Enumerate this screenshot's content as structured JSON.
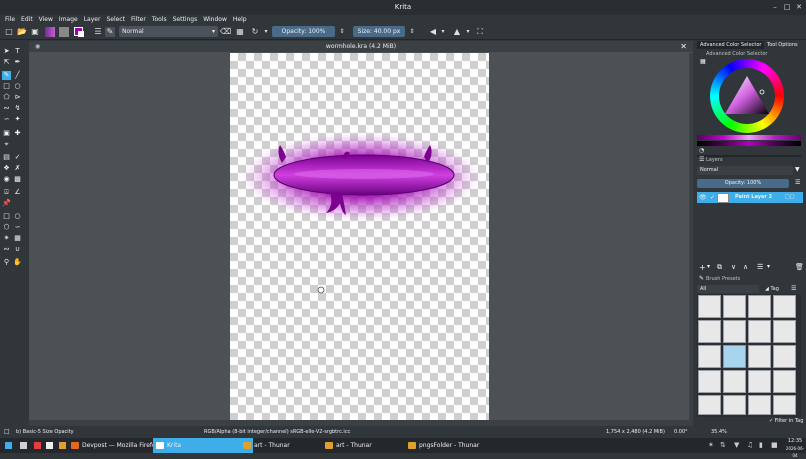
{
  "window": {
    "title": "Krita"
  },
  "menu": [
    "File",
    "Edit",
    "View",
    "Image",
    "Layer",
    "Select",
    "Filter",
    "Tools",
    "Settings",
    "Window",
    "Help"
  ],
  "toolbar": {
    "blend_mode": "Normal",
    "opacity": "Opacity: 100%",
    "size": "Size: 40.00 px"
  },
  "document": {
    "tab_title": "wormhole.kra (4.2 MiB)"
  },
  "right_panel": {
    "tabs": [
      "Advanced Color Selector",
      "Tool Options"
    ],
    "color_selector_header": "Advanced Color Selector",
    "layers_header": "Layers",
    "layer_blend_mode": "Normal",
    "layer_opacity": "Opacity: 100%",
    "layers": [
      {
        "name": "Paint Layer 2"
      }
    ],
    "brush_presets_header": "Brush Presets",
    "brush_filter": "All",
    "tag_label": "Tag",
    "filter_in_tag": "Filter in Tag"
  },
  "status": {
    "brush": "b) Basic-5 Size Opacity",
    "color_info": "RGB/Alpha (8-bit integer/channel)  sRGB-elle-V2-srgbtrc.icc",
    "dims": "1,754 x 2,480 (4.2 MiB)",
    "rotation": "0.00°",
    "zoom": "35.4%"
  },
  "taskbar": {
    "items": [
      "Devpost — Mozilla Firefox",
      "Krita",
      "art - Thunar",
      "art - Thunar",
      "pngsFolder - Thunar"
    ],
    "clock": "12:35",
    "date": "2026-06-04"
  },
  "colors": {
    "accent": "#3daee9",
    "paint": "#a000b0"
  }
}
